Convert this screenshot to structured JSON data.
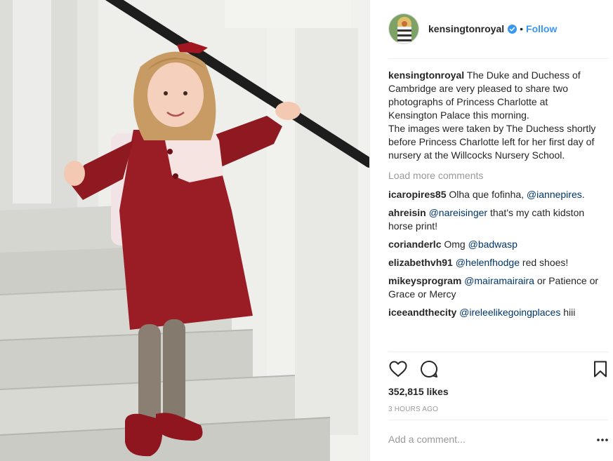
{
  "post": {
    "username": "kensingtonroyal",
    "separator": "•",
    "follow_label": "Follow",
    "caption_lines": [
      "The Duke and Duchess of Cambridge are very pleased to share two photographs of Princess Charlotte at Kensington Palace this morning.",
      "The images were taken by The Duchess shortly before Princess Charlotte left for her first day of nursery at the Willcocks Nursery School."
    ],
    "load_more_label": "Load more comments",
    "comments": [
      {
        "user": "icaropires85",
        "text": "Olha que fofinha,",
        "mention": "@iannepires",
        "after": "."
      },
      {
        "user": "ahreisin",
        "text": "",
        "mention": "@nareisinger",
        "after": "that's my cath kidston horse print!"
      },
      {
        "user": "corianderlc",
        "text": "Omg",
        "mention": "@badwasp",
        "after": ""
      },
      {
        "user": "elizabethvh91",
        "text": "",
        "mention": "@helenfhodge",
        "after": "red shoes!"
      },
      {
        "user": "mikeysprogram",
        "text": "",
        "mention": "@mairamairaira",
        "after": "or Patience or Grace or Mercy"
      },
      {
        "user": "iceeandthecity",
        "text": "",
        "mention": "@ireleelikegoingplaces",
        "after": "hiii"
      }
    ],
    "likes": "352,815 likes",
    "time_ago": "3 HOURS AGO",
    "add_comment_placeholder": "Add a comment...",
    "icons": {
      "like": "heart-outline-icon",
      "comment": "speech-bubble-icon",
      "save": "bookmark-icon",
      "more": "ellipsis-icon",
      "verified": "verified-badge-icon"
    },
    "colors": {
      "link": "#3897f0",
      "mention": "#003569",
      "muted": "#999999",
      "text": "#262626",
      "coat": "#9a1c25"
    }
  }
}
